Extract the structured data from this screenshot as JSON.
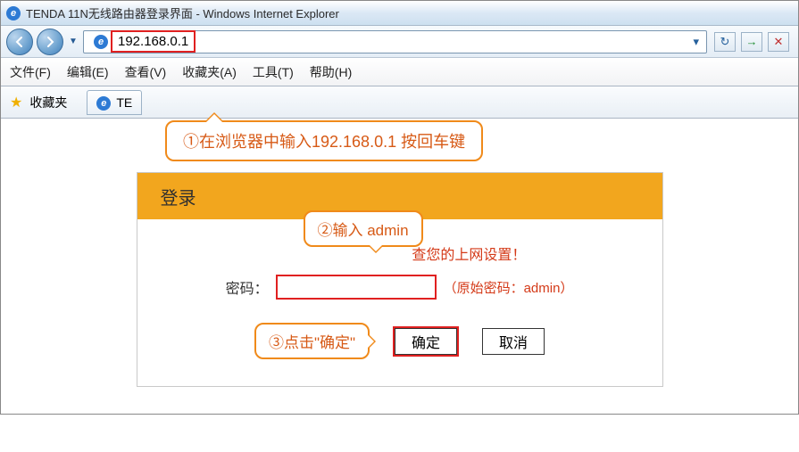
{
  "window": {
    "title": "TENDA 11N无线路由器登录界面 - Windows Internet Explorer"
  },
  "address": {
    "url": "192.168.0.1",
    "dropdown_glyph": "▾"
  },
  "toolbar_right": {
    "refresh_glyph": "↻",
    "go_glyph": "→",
    "stop_glyph": "✕"
  },
  "menu": {
    "file": "文件(F)",
    "edit": "编辑(E)",
    "view": "查看(V)",
    "favorites": "收藏夹(A)",
    "tools": "工具(T)",
    "help": "帮助(H)"
  },
  "favbar": {
    "label": "收藏夹",
    "tab_label": "TE"
  },
  "login": {
    "heading": "登录",
    "message_suffix": "查您的上网设置！",
    "password_label": "密码：",
    "hint": "（原始密码：admin）",
    "ok_label": "确定",
    "cancel_label": "取消"
  },
  "callouts": {
    "step1": "①在浏览器中输入192.168.0.1 按回车键",
    "step2": "②输入 admin",
    "step3": "③点击\"确定\""
  }
}
